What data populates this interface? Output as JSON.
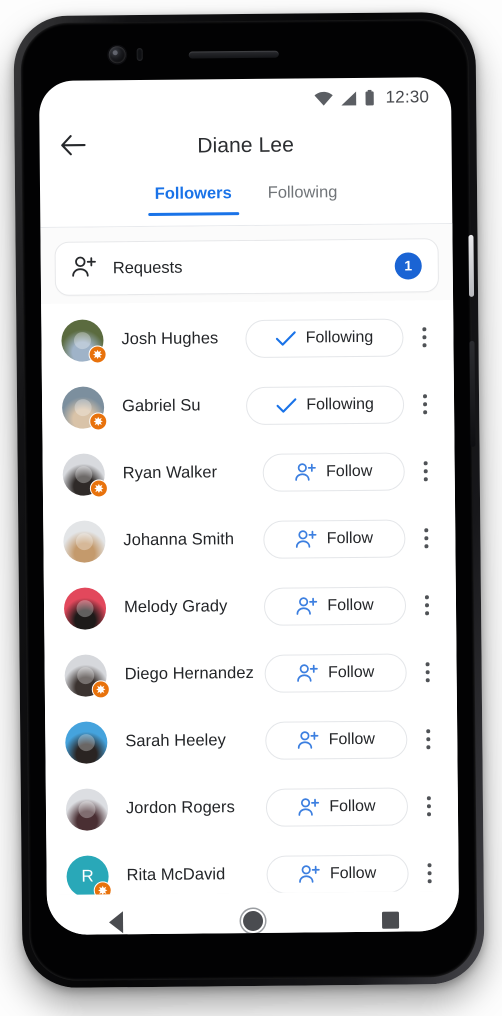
{
  "status_bar": {
    "time": "12:30",
    "icons": [
      "wifi-icon",
      "cellular-signal-icon",
      "battery-icon"
    ]
  },
  "app_bar": {
    "back_icon": "back-arrow-icon",
    "title": "Diane Lee"
  },
  "tabs": [
    {
      "label": "Followers",
      "active": true
    },
    {
      "label": "Following",
      "active": false
    }
  ],
  "requests": {
    "icon": "person-add-icon",
    "label": "Requests",
    "count": "1",
    "badge_color": "#1a64d4"
  },
  "colors": {
    "accent_blue": "#1a73e8",
    "badge_orange": "#e8720c",
    "text_primary": "#232528",
    "text_secondary": "#707478"
  },
  "people": [
    {
      "name": "Josh Hughes",
      "action": "Following",
      "action_icon": "check-icon",
      "has_badge": true,
      "avatar_type": "photo",
      "avatar_bg": "#5b6b3f",
      "avatar_bg2": "#9fb3c8",
      "initial": ""
    },
    {
      "name": "Gabriel Su",
      "action": "Following",
      "action_icon": "check-icon",
      "has_badge": true,
      "avatar_type": "photo",
      "avatar_bg": "#7c8f9e",
      "avatar_bg2": "#d9c3a8",
      "initial": ""
    },
    {
      "name": "Ryan Walker",
      "action": "Follow",
      "action_icon": "person-add-icon",
      "has_badge": true,
      "avatar_type": "photo",
      "avatar_bg": "#d8dade",
      "avatar_bg2": "#2f2a28",
      "initial": ""
    },
    {
      "name": "Johanna Smith",
      "action": "Follow",
      "action_icon": "person-add-icon",
      "has_badge": false,
      "avatar_type": "photo",
      "avatar_bg": "#e3e5e7",
      "avatar_bg2": "#c49a6c",
      "initial": ""
    },
    {
      "name": "Melody Grady",
      "action": "Follow",
      "action_icon": "person-add-icon",
      "has_badge": false,
      "avatar_type": "photo",
      "avatar_bg": "#e2485c",
      "avatar_bg2": "#1d1a19",
      "initial": ""
    },
    {
      "name": "Diego Hernandez",
      "action": "Follow",
      "action_icon": "person-add-icon",
      "has_badge": true,
      "avatar_type": "photo",
      "avatar_bg": "#d6d8dc",
      "avatar_bg2": "#3b3330",
      "initial": ""
    },
    {
      "name": "Sarah Heeley",
      "action": "Follow",
      "action_icon": "person-add-icon",
      "has_badge": false,
      "avatar_type": "photo",
      "avatar_bg": "#45a3dd",
      "avatar_bg2": "#2a2422",
      "initial": ""
    },
    {
      "name": "Jordon Rogers",
      "action": "Follow",
      "action_icon": "person-add-icon",
      "has_badge": false,
      "avatar_type": "photo",
      "avatar_bg": "#dcdee2",
      "avatar_bg2": "#4a2f33",
      "initial": ""
    },
    {
      "name": "Rita McDavid",
      "action": "Follow",
      "action_icon": "person-add-icon",
      "has_badge": true,
      "avatar_type": "initial",
      "avatar_bg": "#29a8b8",
      "avatar_bg2": "#29a8b8",
      "initial": "R"
    }
  ],
  "nav_bar": {
    "back": "nav-back-icon",
    "home": "nav-home-icon",
    "recents": "nav-recents-icon"
  }
}
